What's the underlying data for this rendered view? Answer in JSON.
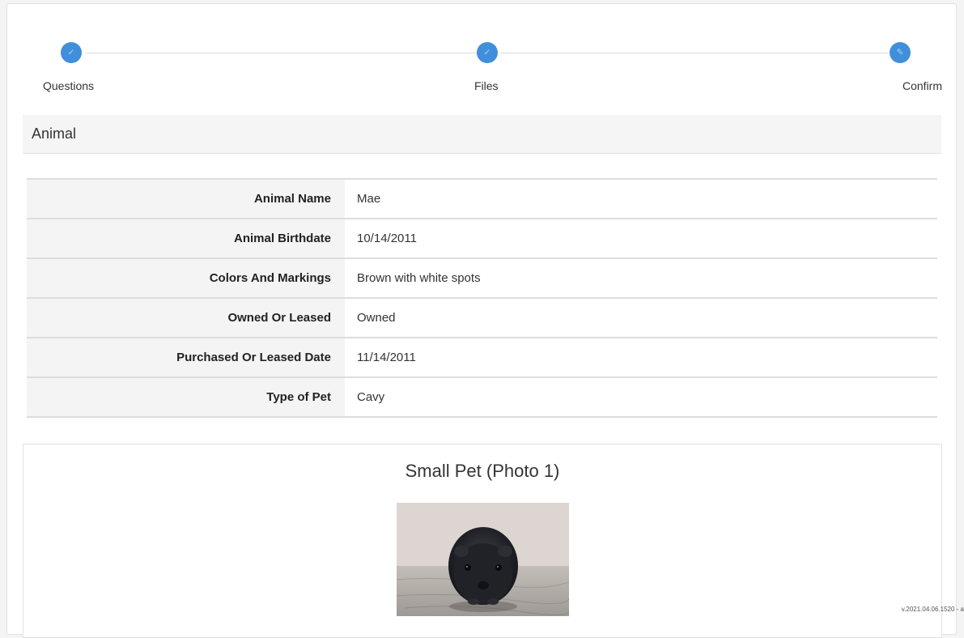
{
  "stepper": {
    "steps": [
      {
        "label": "Questions",
        "icon": "check-icon",
        "state": "complete"
      },
      {
        "label": "Files",
        "icon": "check-icon",
        "state": "complete"
      },
      {
        "label": "Confirm",
        "icon": "pencil-icon",
        "state": "current"
      }
    ],
    "accent_color": "#3f8fdb"
  },
  "section": {
    "title": "Animal"
  },
  "details": {
    "rows": [
      {
        "label": "Animal Name",
        "value": "Mae"
      },
      {
        "label": "Animal Birthdate",
        "value": "10/14/2011"
      },
      {
        "label": "Colors And Markings",
        "value": "Brown with white spots"
      },
      {
        "label": "Owned Or Leased",
        "value": "Owned"
      },
      {
        "label": "Purchased Or Leased Date",
        "value": "11/14/2011"
      },
      {
        "label": "Type of Pet",
        "value": "Cavy"
      }
    ]
  },
  "photo": {
    "title": "Small Pet (Photo 1)"
  },
  "footer": {
    "version": "v.2021.04.06.1520 - a"
  }
}
